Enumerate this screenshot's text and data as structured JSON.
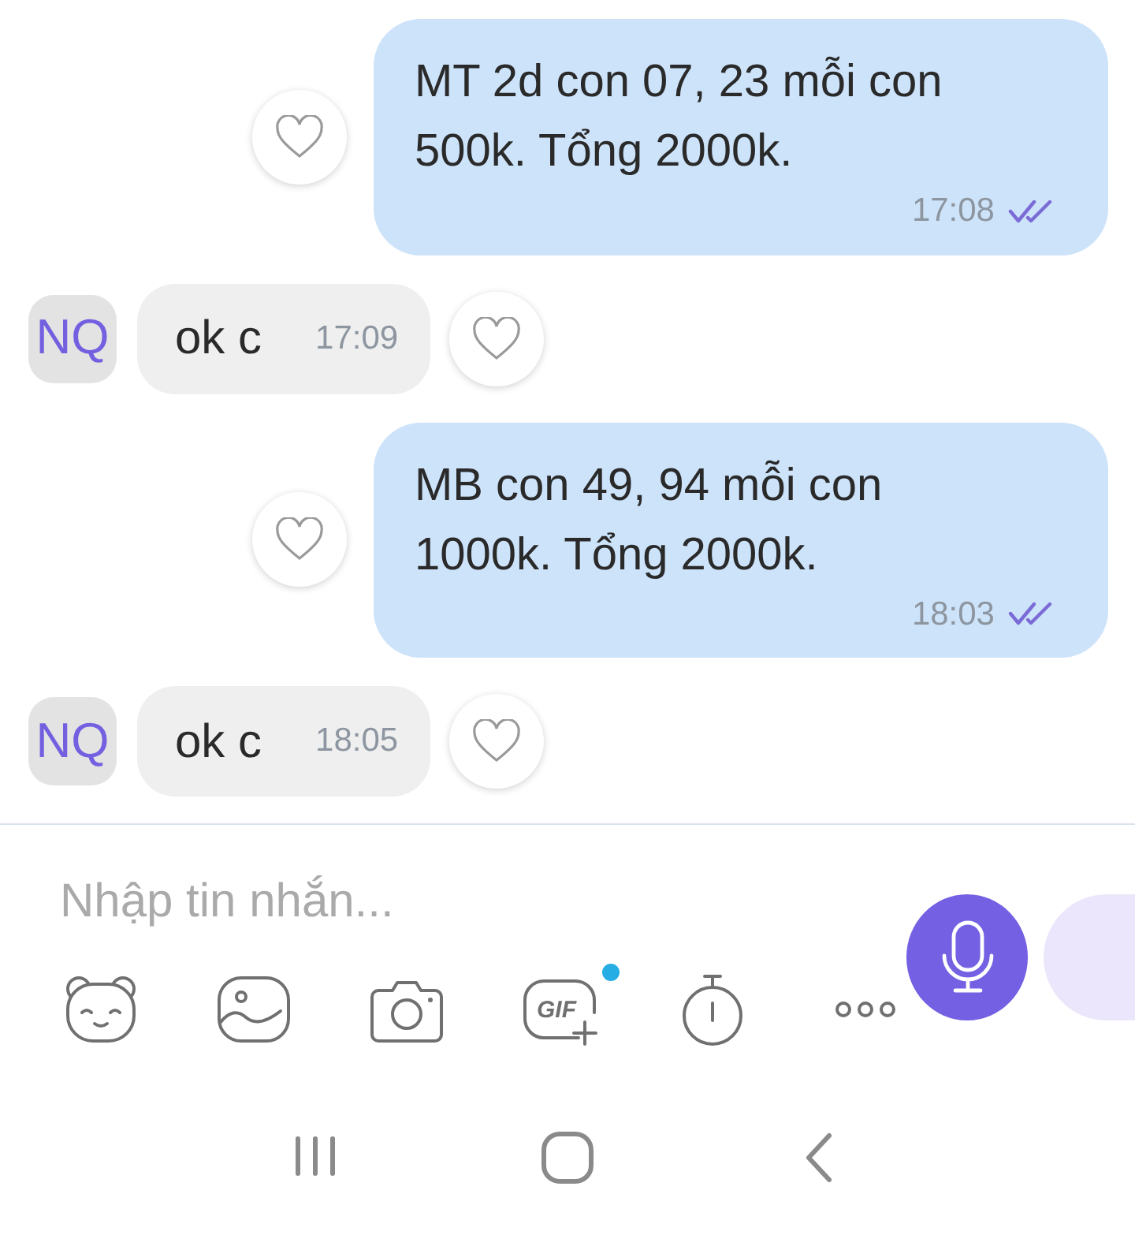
{
  "messages": [
    {
      "kind": "outgoing",
      "text": "MT 2d con 07, 23 mỗi con 500k. Tổng 2000k.",
      "time": "17:08",
      "read": true
    },
    {
      "kind": "incoming",
      "avatar": "NQ",
      "text": "ok c",
      "time": "17:09"
    },
    {
      "kind": "outgoing",
      "text": "MB con 49, 94 mỗi con 1000k. Tổng 2000k.",
      "time": "18:03",
      "read": true
    },
    {
      "kind": "incoming",
      "avatar": "NQ",
      "text": "ok c",
      "time": "18:05"
    }
  ],
  "composer": {
    "placeholder": "Nhập tin nhắn..."
  },
  "toolbar": [
    {
      "kind": "sticker",
      "dot": false
    },
    {
      "kind": "gallery",
      "dot": false
    },
    {
      "kind": "camera",
      "dot": false
    },
    {
      "kind": "gif",
      "label": "GIF",
      "dot": true
    },
    {
      "kind": "timer",
      "dot": false
    },
    {
      "kind": "more",
      "dot": false
    }
  ],
  "nav_bar": [
    {
      "kind": "recents"
    },
    {
      "kind": "home"
    },
    {
      "kind": "back"
    }
  ]
}
